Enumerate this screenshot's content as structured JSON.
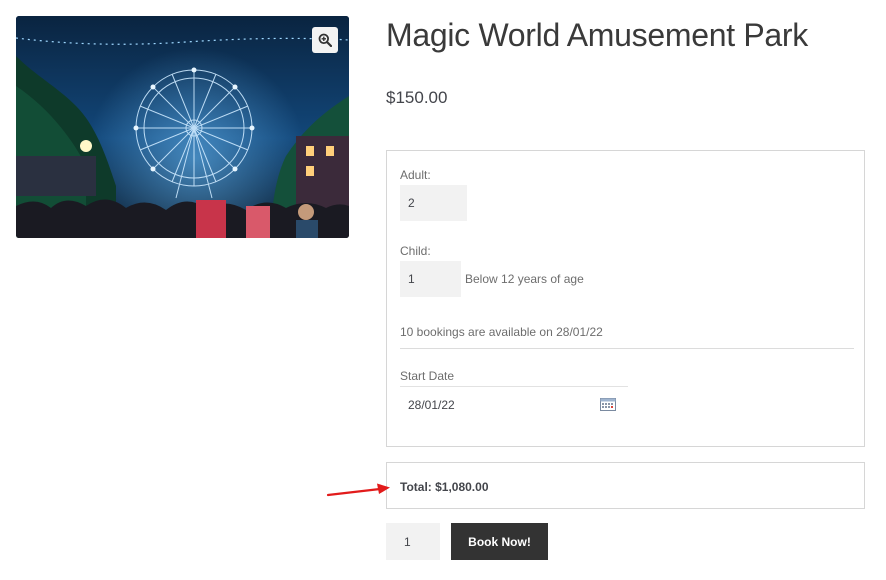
{
  "product": {
    "title": "Magic World Amusement Park",
    "price": "$150.00",
    "image_icon": "zoom-in-icon"
  },
  "booking": {
    "adult": {
      "label": "Adult:",
      "value": "2"
    },
    "child": {
      "label": "Child:",
      "value": "1",
      "note": "Below 12 years of age"
    },
    "availability": "10 bookings are available on 28/01/22",
    "start_date": {
      "label": "Start Date",
      "value": "28/01/22",
      "icon": "calendar-icon"
    }
  },
  "total": {
    "text": "Total: $1,080.00"
  },
  "cart": {
    "quantity": "1",
    "button_label": "Book Now!"
  },
  "colors": {
    "button_bg": "#333333",
    "input_bg": "#f2f2f2",
    "border": "#d6d6d6",
    "annotation_arrow": "#e21b1b"
  }
}
